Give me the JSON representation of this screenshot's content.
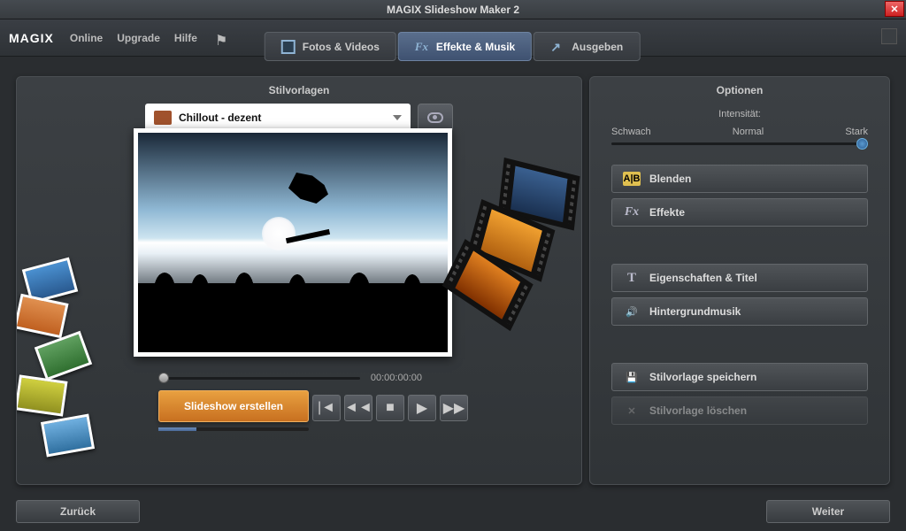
{
  "window": {
    "title": "MAGIX Slideshow Maker 2"
  },
  "logo": "MAGIX",
  "menu": {
    "online": "Online",
    "upgrade": "Upgrade",
    "help": "Hilfe"
  },
  "tabs": {
    "photos": "Fotos & Videos",
    "effects": "Effekte & Musik",
    "export": "Ausgeben"
  },
  "left": {
    "title": "Stilvorlagen",
    "style_name": "Chillout - dezent",
    "timecode": "00:00:00:00",
    "create": "Slideshow erstellen"
  },
  "right": {
    "title": "Optionen",
    "intensity_label": "Intensität:",
    "scale": {
      "weak": "Schwach",
      "normal": "Normal",
      "strong": "Stark"
    },
    "btn_blend": "Blenden",
    "btn_effects": "Effekte",
    "btn_props": "Eigenschaften & Titel",
    "btn_music": "Hintergrundmusik",
    "btn_save": "Stilvorlage speichern",
    "btn_delete": "Stilvorlage löschen"
  },
  "nav": {
    "back": "Zurück",
    "next": "Weiter"
  }
}
